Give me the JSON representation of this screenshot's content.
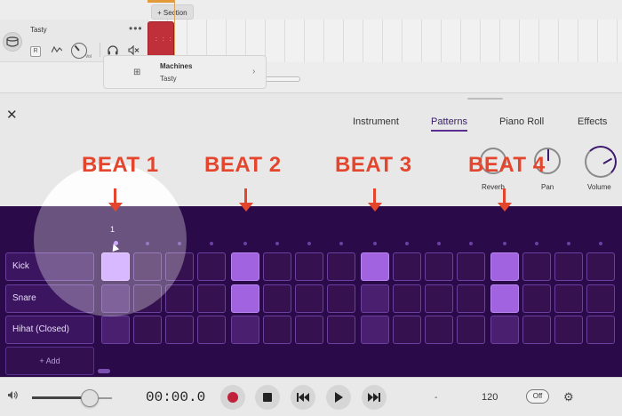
{
  "track": {
    "name": "Tasty",
    "menu_glyph": "•••",
    "record_badge": "R",
    "volume_caption": "Vol"
  },
  "timeline": {
    "section_button": "+ Section",
    "clip_glyph": ": : :"
  },
  "panel": {
    "close_glyph": "✕",
    "tabs": [
      "Instrument",
      "Patterns",
      "Piano Roll",
      "Effects"
    ],
    "active_tab": "Patterns",
    "instrument": {
      "line1": "Machines",
      "line2": "Tasty",
      "chevron": "›"
    },
    "knobs": [
      {
        "label": "Reverb",
        "value": 0.0
      },
      {
        "label": "Pan",
        "value": 0.5
      },
      {
        "label": "Volume",
        "value": 0.75
      }
    ]
  },
  "annotations": {
    "beats": [
      "BEAT 1",
      "BEAT 2",
      "BEAT 3",
      "BEAT 4"
    ],
    "color": "#e4462d"
  },
  "sequencer": {
    "current_step_label": "1",
    "steps": 16,
    "rows": [
      {
        "label": "Kick",
        "active_steps": [
          1,
          5,
          9,
          13
        ]
      },
      {
        "label": "Snare",
        "active_steps": [
          5,
          13
        ]
      },
      {
        "label": "Hihat (Closed)",
        "active_steps": []
      }
    ],
    "add_button": "+ Add",
    "accent": "#a163e0"
  },
  "transport": {
    "volume_level": 0.72,
    "time": "00:00.0",
    "position_display": "-",
    "tempo": "120",
    "metronome": "Off"
  }
}
